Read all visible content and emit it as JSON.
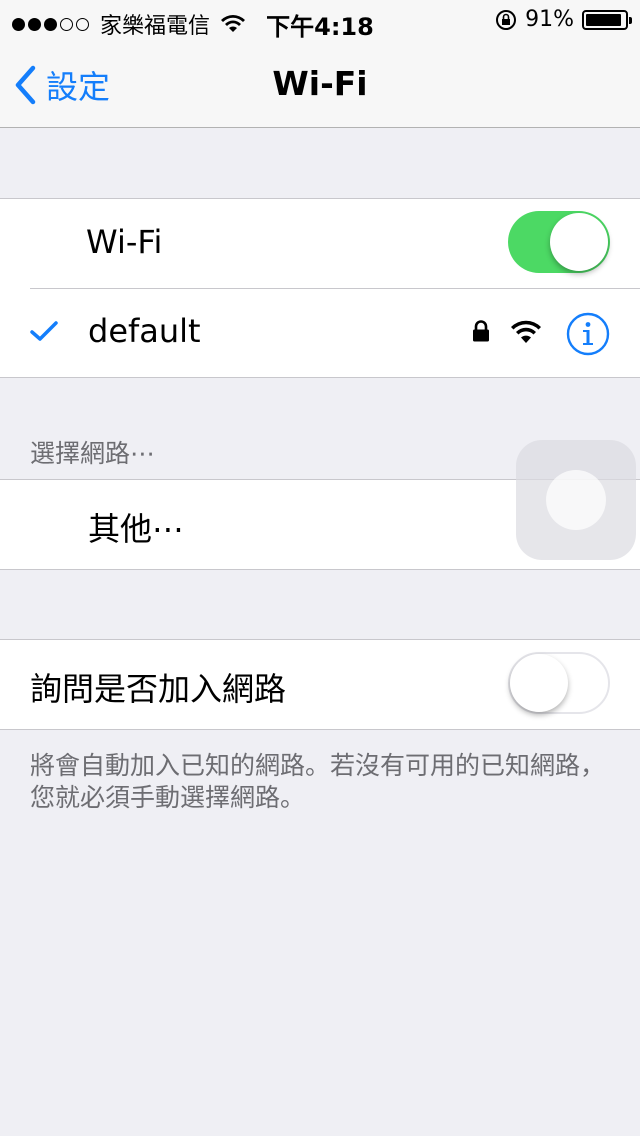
{
  "status_bar": {
    "signal_bars_filled": 3,
    "signal_bars_total": 5,
    "carrier": "家樂福電信",
    "time": "下午4:18",
    "battery_percent": "91%",
    "battery_level": 0.91
  },
  "nav": {
    "back_label": "設定",
    "title": "Wi-Fi"
  },
  "wifi_group": {
    "toggle_label": "Wi-Fi",
    "toggle_on": true,
    "connected_network": "default"
  },
  "choose_network": {
    "header": "選擇網路⋯",
    "other_label": "其他⋯"
  },
  "ask_join": {
    "label": "詢問是否加入網路",
    "toggle_on": false,
    "footer": "將會自動加入已知的網路。若沒有可用的已知網路，您就必須手動選擇網路。"
  },
  "colors": {
    "accent": "#147efb",
    "toggle_on": "#4cd964",
    "background": "#efeff4"
  }
}
